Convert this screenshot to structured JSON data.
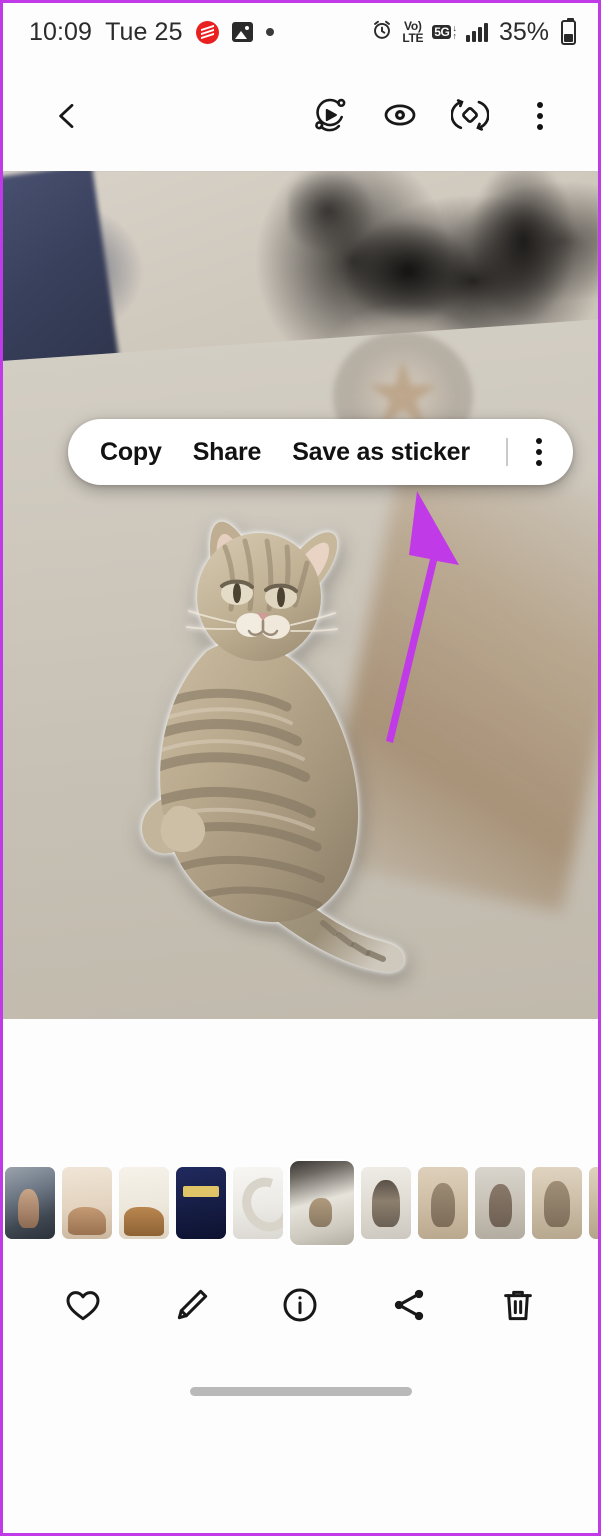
{
  "meta": {
    "app": "Samsung Gallery photo viewer",
    "accent_annotation_color": "#c13ae8",
    "popup_background": "#ffffff",
    "screen_background": "#fdfdfd"
  },
  "status_bar": {
    "time": "10:09",
    "date": "Tue 25",
    "left_icons": [
      {
        "name": "screen-recorder-icon",
        "glyph": "red-record"
      },
      {
        "name": "gallery-notification-icon",
        "glyph": "photo"
      },
      {
        "name": "notification-dot-icon",
        "glyph": "dot"
      }
    ],
    "right_icons": [
      {
        "name": "alarm-icon",
        "glyph": "alarm-clock"
      },
      {
        "name": "volte-icon",
        "line1": "Vo)",
        "line2": "LTE"
      },
      {
        "name": "network-5g-icon",
        "label": "5G",
        "arrows": "↓↑"
      },
      {
        "name": "signal-strength-icon",
        "bars": 4
      }
    ],
    "battery_percent": "35%",
    "battery_level": 35
  },
  "top_toolbar": {
    "back_label": "Back",
    "actions": [
      {
        "name": "motion-photo-button",
        "label": "Motion photo"
      },
      {
        "name": "visual-search-button",
        "label": "Visual search"
      },
      {
        "name": "remaster-button",
        "label": "Remaster picture"
      },
      {
        "name": "more-options-button",
        "label": "More options"
      }
    ]
  },
  "photo": {
    "subject": "Tabby cat lying on a concrete floor",
    "sticker_cutout_active": true,
    "cutout_outline_color": "#ffffff"
  },
  "context_popup": {
    "items": [
      {
        "name": "popup-copy",
        "label": "Copy"
      },
      {
        "name": "popup-share",
        "label": "Share"
      },
      {
        "name": "popup-save-as-sticker",
        "label": "Save as sticker"
      }
    ],
    "overflow_label": "More options"
  },
  "annotation": {
    "name": "instruction-arrow",
    "points_to": "Save as sticker",
    "color": "#c13ae8"
  },
  "filmstrip": {
    "selected_index": 5,
    "thumbnails": [
      {
        "name": "thumbnail-1",
        "label": "Woman by window",
        "style": "tv-woman"
      },
      {
        "name": "thumbnail-2",
        "label": "Eid al-Adha beige card",
        "style": "tv-beige"
      },
      {
        "name": "thumbnail-3",
        "label": "Eid al-Adha camel card",
        "style": "tv-camel"
      },
      {
        "name": "thumbnail-4",
        "label": "Eid al-Adha Mubarak navy card",
        "style": "tv-navy"
      },
      {
        "name": "thumbnail-5",
        "label": "Eid al-Adha crescent moon card",
        "style": "tv-moon"
      },
      {
        "name": "thumbnail-6",
        "label": "Cat on floor (current photo)",
        "style": "tv-catfloor"
      },
      {
        "name": "thumbnail-7",
        "label": "Cat standing",
        "style": "tv-catstand"
      },
      {
        "name": "thumbnail-8",
        "label": "Cat sitting on sand 1",
        "style": "tv-catsand1"
      },
      {
        "name": "thumbnail-9",
        "label": "Cat sitting on sand 2",
        "style": "tv-catsand2"
      },
      {
        "name": "thumbnail-10",
        "label": "Cat sitting on sand 3",
        "style": "tv-catsand3"
      },
      {
        "name": "thumbnail-11",
        "label": "Cat sitting on sand 4",
        "style": "tv-catsand4"
      }
    ]
  },
  "bottom_bar": {
    "actions": [
      {
        "name": "favorite-button",
        "label": "Favorite"
      },
      {
        "name": "edit-button",
        "label": "Edit"
      },
      {
        "name": "info-button",
        "label": "Details"
      },
      {
        "name": "share-button",
        "label": "Share"
      },
      {
        "name": "delete-button",
        "label": "Delete"
      }
    ]
  },
  "home_indicator": {
    "label": "Home gesture bar"
  }
}
